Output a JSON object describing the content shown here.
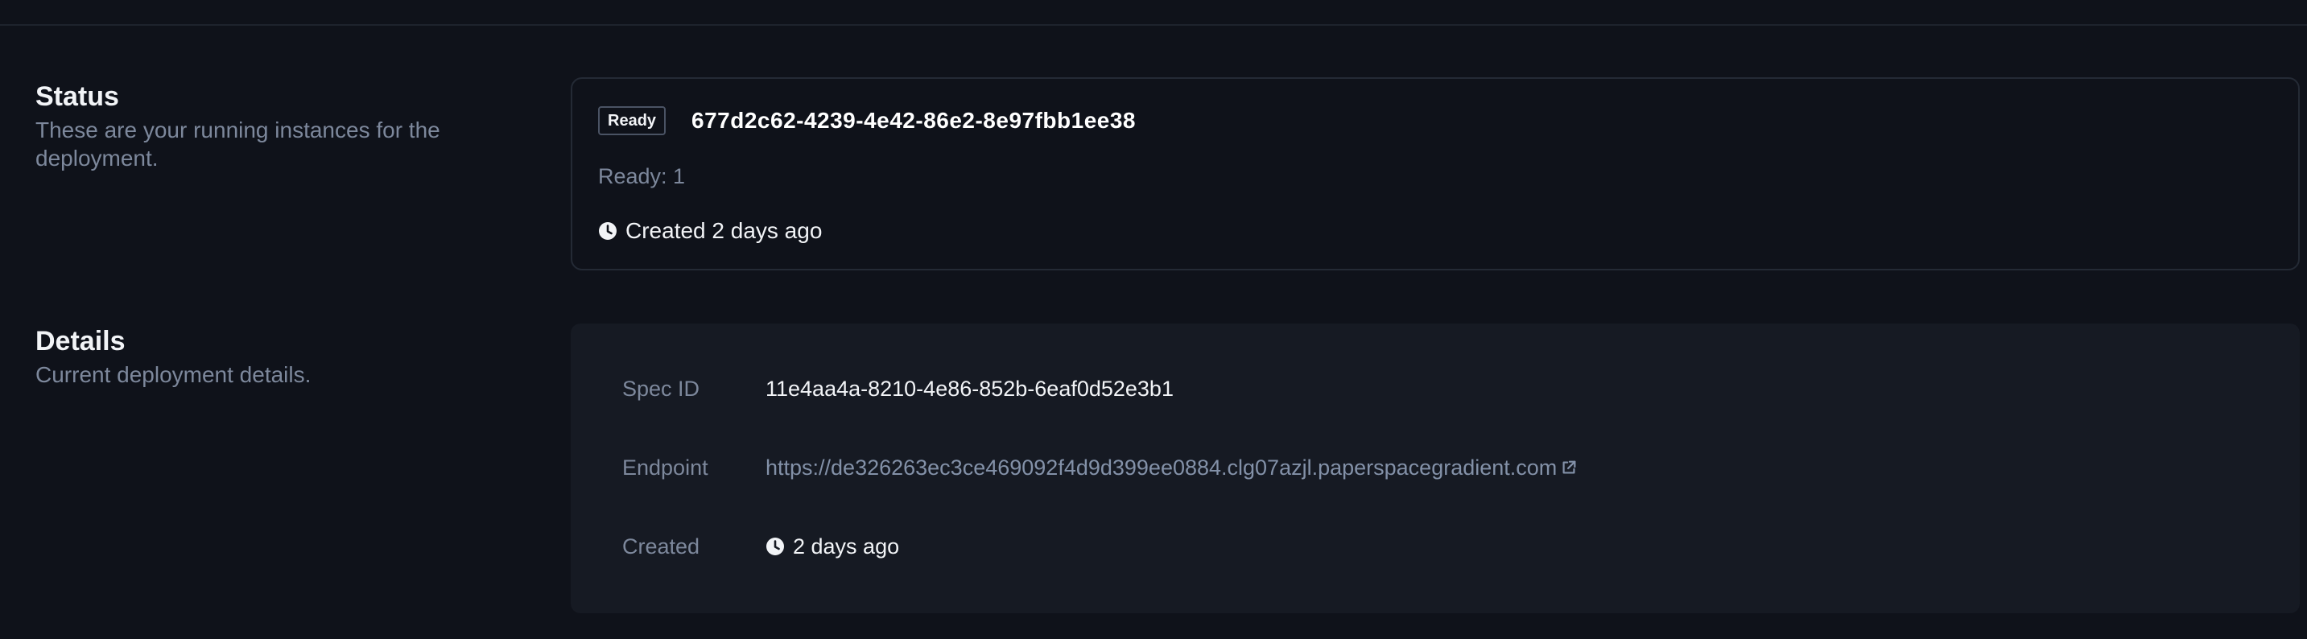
{
  "status": {
    "title": "Status",
    "description": "These are your running instances for the deployment.",
    "instance": {
      "badge": "Ready",
      "id": "677d2c62-4239-4e42-86e2-8e97fbb1ee38",
      "ready_count": "Ready: 1",
      "created": "Created 2 days ago",
      "created_icon": "clock-icon"
    }
  },
  "details": {
    "title": "Details",
    "description": "Current deployment details.",
    "rows": {
      "spec_id": {
        "label": "Spec ID",
        "value": "11e4aa4a-8210-4e86-852b-6eaf0d52e3b1"
      },
      "endpoint": {
        "label": "Endpoint",
        "value": "https://de326263ec3ce469092f4d9d399ee0884.clg07azjl.paperspacegradient.com",
        "icon": "external-link-icon"
      },
      "created": {
        "label": "Created",
        "value": "2 days ago",
        "icon": "clock-icon"
      }
    }
  },
  "colors": {
    "background": "#0f121a",
    "card_border": "#242a35",
    "details_card_bg": "#161a23",
    "muted_text": "#7d889c",
    "primary_text": "#f2f4f7",
    "link_text": "#8391a8"
  }
}
